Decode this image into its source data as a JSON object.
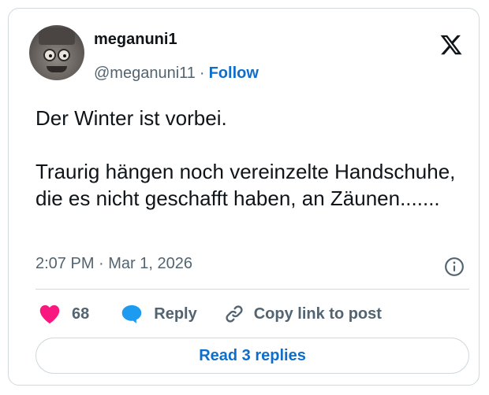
{
  "tweet": {
    "display_name": "meganuni1",
    "handle": "@meganuni11",
    "separator": "·",
    "follow_label": "Follow",
    "text": "Der Winter ist vorbei.\n\nTraurig hängen noch vereinzelte Handschuhe, die es nicht geschafft haben, an Zäunen.......",
    "timestamp": "2:07 PM · Mar 1, 2026",
    "likes_count": "68",
    "reply_label": "Reply",
    "copy_link_label": "Copy link to post",
    "read_replies_label": "Read 3 replies"
  },
  "icons": {
    "logo": "x-logo-icon",
    "info": "info-icon",
    "like": "heart-icon",
    "reply": "speech-bubble-icon",
    "copy": "link-icon"
  },
  "colors": {
    "accent": "#0f6ec9",
    "heart": "#f91880",
    "reply_bubble": "#1d9bf0",
    "muted": "#536471",
    "border": "#cfd9de"
  }
}
